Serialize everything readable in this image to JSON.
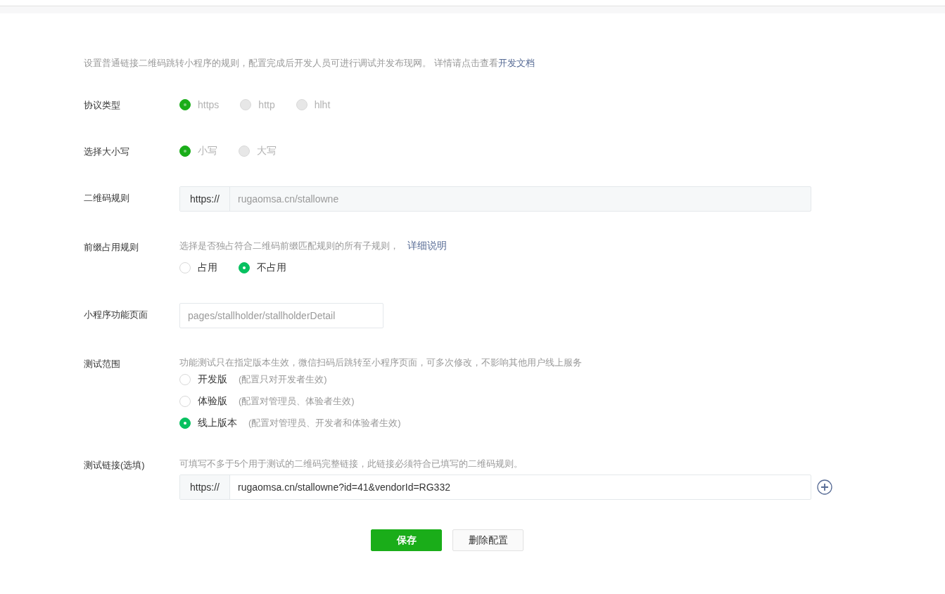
{
  "intro": {
    "text": "设置普通链接二维码跳转小程序的规则，配置完成后开发人员可进行调试并发布现网。 详情请点击查看",
    "link": "开发文档"
  },
  "fields": [
    {
      "kind": "radio",
      "label": "协议类型",
      "disabled": true,
      "options": [
        {
          "label": "https",
          "selected": true
        },
        {
          "label": "http",
          "selected": false
        },
        {
          "label": "hlht",
          "selected": false
        }
      ]
    },
    {
      "kind": "radio",
      "label": "选择大小写",
      "disabled": true,
      "options": [
        {
          "label": "小写",
          "selected": true
        },
        {
          "label": "大写",
          "selected": false
        }
      ]
    },
    {
      "kind": "prefixed",
      "label": "二维码规则",
      "prefix": "https://",
      "value": "rugaomsa.cn/stallowne",
      "disabled": true
    },
    {
      "kind": "radio",
      "label": "前缀占用规则",
      "hint": "选择是否独占符合二维码前缀匹配规则的所有子规则，",
      "link": "详细说明",
      "disabled": false,
      "options": [
        {
          "label": "占用",
          "selected": false
        },
        {
          "label": "不占用",
          "selected": true
        }
      ]
    },
    {
      "kind": "input",
      "label": "小程序功能页面",
      "placeholder": "pages/stallholder/stallholderDetail"
    },
    {
      "kind": "radio_list",
      "label": "测试范围",
      "hint": "功能测试只在指定版本生效，微信扫码后跳转至小程序页面，可多次修改，不影响其他用户线上服务",
      "options": [
        {
          "label": "开发版",
          "note": "(配置只对开发者生效)",
          "selected": false
        },
        {
          "label": "体验版",
          "note": "(配置对管理员、体验者生效)",
          "selected": false
        },
        {
          "label": "线上版本",
          "note": "(配置对管理员、开发者和体验者生效)",
          "selected": true
        }
      ]
    },
    {
      "kind": "prefixed",
      "label": "测试链接(选填)",
      "hint": "可填写不多于5个用于测试的二维码完整链接，此链接必须符合已填写的二维码规则。",
      "prefix": "https://",
      "value": "rugaomsa.cn/stallowne?id=41&vendorId=RG332",
      "disabled": false,
      "addable": true
    }
  ],
  "buttons": [
    {
      "label": "保存",
      "kind": "primary"
    },
    {
      "label": "删除配置",
      "kind": "default"
    }
  ]
}
